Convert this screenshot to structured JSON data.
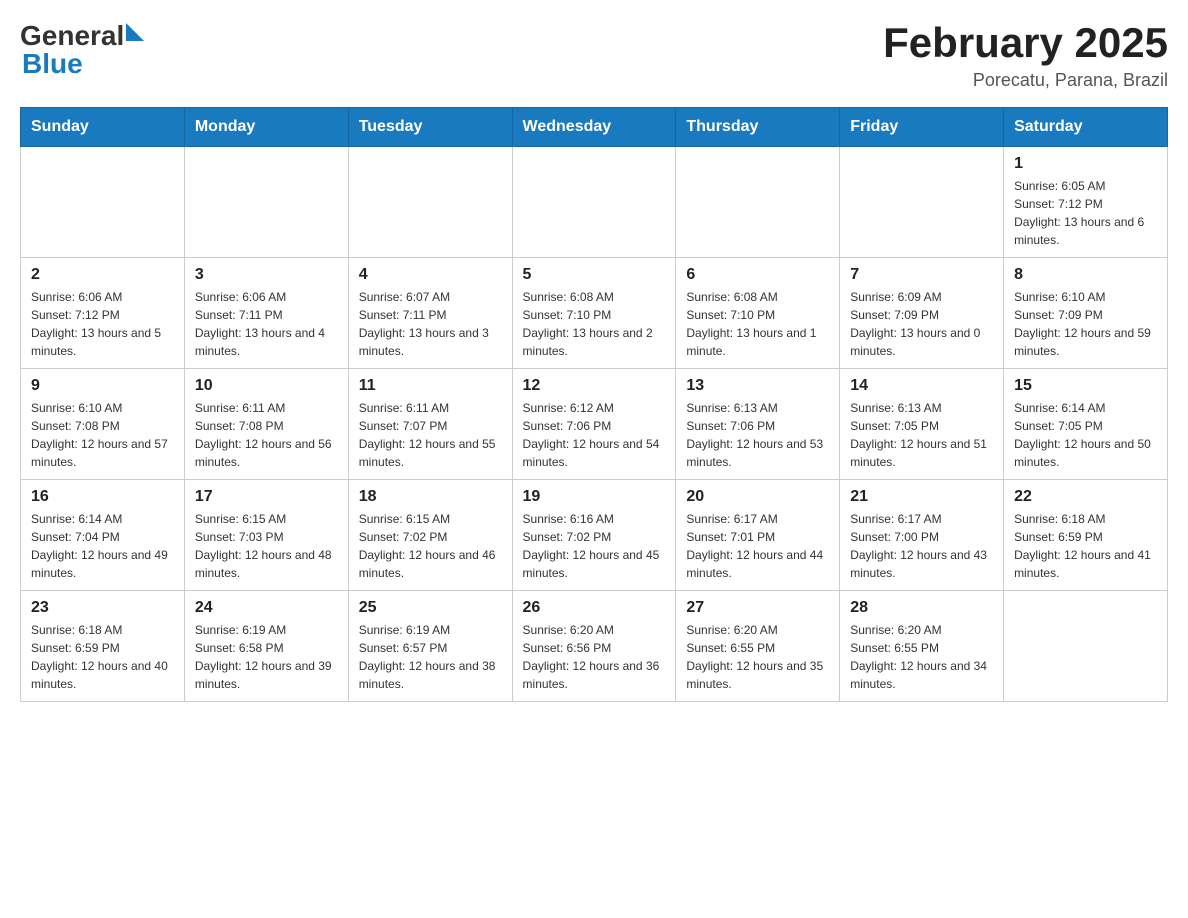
{
  "header": {
    "logo": {
      "general": "General",
      "blue": "Blue",
      "arrow_color": "#1a7abf"
    },
    "title": "February 2025",
    "subtitle": "Porecatu, Parana, Brazil"
  },
  "calendar": {
    "days_of_week": [
      "Sunday",
      "Monday",
      "Tuesday",
      "Wednesday",
      "Thursday",
      "Friday",
      "Saturday"
    ],
    "weeks": [
      [
        {
          "day": "",
          "info": ""
        },
        {
          "day": "",
          "info": ""
        },
        {
          "day": "",
          "info": ""
        },
        {
          "day": "",
          "info": ""
        },
        {
          "day": "",
          "info": ""
        },
        {
          "day": "",
          "info": ""
        },
        {
          "day": "1",
          "info": "Sunrise: 6:05 AM\nSunset: 7:12 PM\nDaylight: 13 hours and 6 minutes."
        }
      ],
      [
        {
          "day": "2",
          "info": "Sunrise: 6:06 AM\nSunset: 7:12 PM\nDaylight: 13 hours and 5 minutes."
        },
        {
          "day": "3",
          "info": "Sunrise: 6:06 AM\nSunset: 7:11 PM\nDaylight: 13 hours and 4 minutes."
        },
        {
          "day": "4",
          "info": "Sunrise: 6:07 AM\nSunset: 7:11 PM\nDaylight: 13 hours and 3 minutes."
        },
        {
          "day": "5",
          "info": "Sunrise: 6:08 AM\nSunset: 7:10 PM\nDaylight: 13 hours and 2 minutes."
        },
        {
          "day": "6",
          "info": "Sunrise: 6:08 AM\nSunset: 7:10 PM\nDaylight: 13 hours and 1 minute."
        },
        {
          "day": "7",
          "info": "Sunrise: 6:09 AM\nSunset: 7:09 PM\nDaylight: 13 hours and 0 minutes."
        },
        {
          "day": "8",
          "info": "Sunrise: 6:10 AM\nSunset: 7:09 PM\nDaylight: 12 hours and 59 minutes."
        }
      ],
      [
        {
          "day": "9",
          "info": "Sunrise: 6:10 AM\nSunset: 7:08 PM\nDaylight: 12 hours and 57 minutes."
        },
        {
          "day": "10",
          "info": "Sunrise: 6:11 AM\nSunset: 7:08 PM\nDaylight: 12 hours and 56 minutes."
        },
        {
          "day": "11",
          "info": "Sunrise: 6:11 AM\nSunset: 7:07 PM\nDaylight: 12 hours and 55 minutes."
        },
        {
          "day": "12",
          "info": "Sunrise: 6:12 AM\nSunset: 7:06 PM\nDaylight: 12 hours and 54 minutes."
        },
        {
          "day": "13",
          "info": "Sunrise: 6:13 AM\nSunset: 7:06 PM\nDaylight: 12 hours and 53 minutes."
        },
        {
          "day": "14",
          "info": "Sunrise: 6:13 AM\nSunset: 7:05 PM\nDaylight: 12 hours and 51 minutes."
        },
        {
          "day": "15",
          "info": "Sunrise: 6:14 AM\nSunset: 7:05 PM\nDaylight: 12 hours and 50 minutes."
        }
      ],
      [
        {
          "day": "16",
          "info": "Sunrise: 6:14 AM\nSunset: 7:04 PM\nDaylight: 12 hours and 49 minutes."
        },
        {
          "day": "17",
          "info": "Sunrise: 6:15 AM\nSunset: 7:03 PM\nDaylight: 12 hours and 48 minutes."
        },
        {
          "day": "18",
          "info": "Sunrise: 6:15 AM\nSunset: 7:02 PM\nDaylight: 12 hours and 46 minutes."
        },
        {
          "day": "19",
          "info": "Sunrise: 6:16 AM\nSunset: 7:02 PM\nDaylight: 12 hours and 45 minutes."
        },
        {
          "day": "20",
          "info": "Sunrise: 6:17 AM\nSunset: 7:01 PM\nDaylight: 12 hours and 44 minutes."
        },
        {
          "day": "21",
          "info": "Sunrise: 6:17 AM\nSunset: 7:00 PM\nDaylight: 12 hours and 43 minutes."
        },
        {
          "day": "22",
          "info": "Sunrise: 6:18 AM\nSunset: 6:59 PM\nDaylight: 12 hours and 41 minutes."
        }
      ],
      [
        {
          "day": "23",
          "info": "Sunrise: 6:18 AM\nSunset: 6:59 PM\nDaylight: 12 hours and 40 minutes."
        },
        {
          "day": "24",
          "info": "Sunrise: 6:19 AM\nSunset: 6:58 PM\nDaylight: 12 hours and 39 minutes."
        },
        {
          "day": "25",
          "info": "Sunrise: 6:19 AM\nSunset: 6:57 PM\nDaylight: 12 hours and 38 minutes."
        },
        {
          "day": "26",
          "info": "Sunrise: 6:20 AM\nSunset: 6:56 PM\nDaylight: 12 hours and 36 minutes."
        },
        {
          "day": "27",
          "info": "Sunrise: 6:20 AM\nSunset: 6:55 PM\nDaylight: 12 hours and 35 minutes."
        },
        {
          "day": "28",
          "info": "Sunrise: 6:20 AM\nSunset: 6:55 PM\nDaylight: 12 hours and 34 minutes."
        },
        {
          "day": "",
          "info": ""
        }
      ]
    ]
  }
}
